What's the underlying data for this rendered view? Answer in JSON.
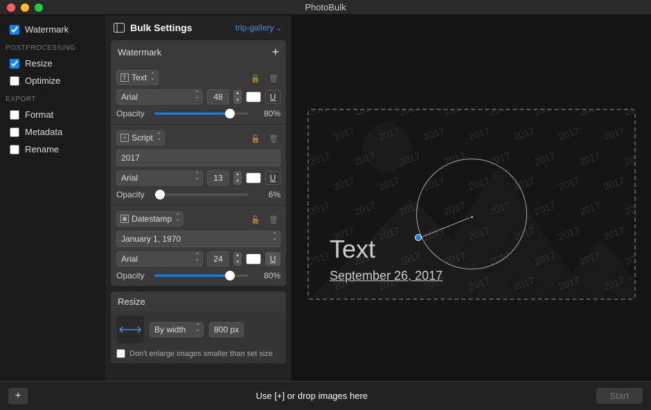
{
  "app_title": "PhotoBulk",
  "sidebar": {
    "watermark_label": "Watermark",
    "group_postprocessing": "POSTPROCESSING",
    "resize_label": "Resize",
    "optimize_label": "Optimize",
    "group_export": "EXPORT",
    "format_label": "Format",
    "metadata_label": "Metadata",
    "rename_label": "Rename"
  },
  "settings_header": {
    "title": "Bulk Settings",
    "preset": "trip-gallery"
  },
  "watermark_panel": {
    "title": "Watermark",
    "items": [
      {
        "type_label": "Text",
        "font": "Arial",
        "size": "48",
        "opacity_label": "Opacity",
        "opacity_value": "80%",
        "opacity_pct": 80
      },
      {
        "type_label": "Script",
        "text_value": "2017",
        "font": "Arial",
        "size": "13",
        "opacity_label": "Opacity",
        "opacity_value": "6%",
        "opacity_pct": 6
      },
      {
        "type_label": "Datestamp",
        "date_value": "January 1, 1970",
        "font": "Arial",
        "size": "24",
        "opacity_label": "Opacity",
        "opacity_value": "80%",
        "opacity_pct": 80
      }
    ]
  },
  "resize_panel": {
    "title": "Resize",
    "mode": "By width",
    "value": "800 px",
    "dont_enlarge_label": "Don't enlarge images smaller than set size"
  },
  "preview": {
    "big_text": "Text",
    "date_text": "September 26, 2017",
    "tile_text": "2017"
  },
  "bottombar": {
    "hint": "Use [+] or drop images here",
    "start_label": "Start"
  }
}
